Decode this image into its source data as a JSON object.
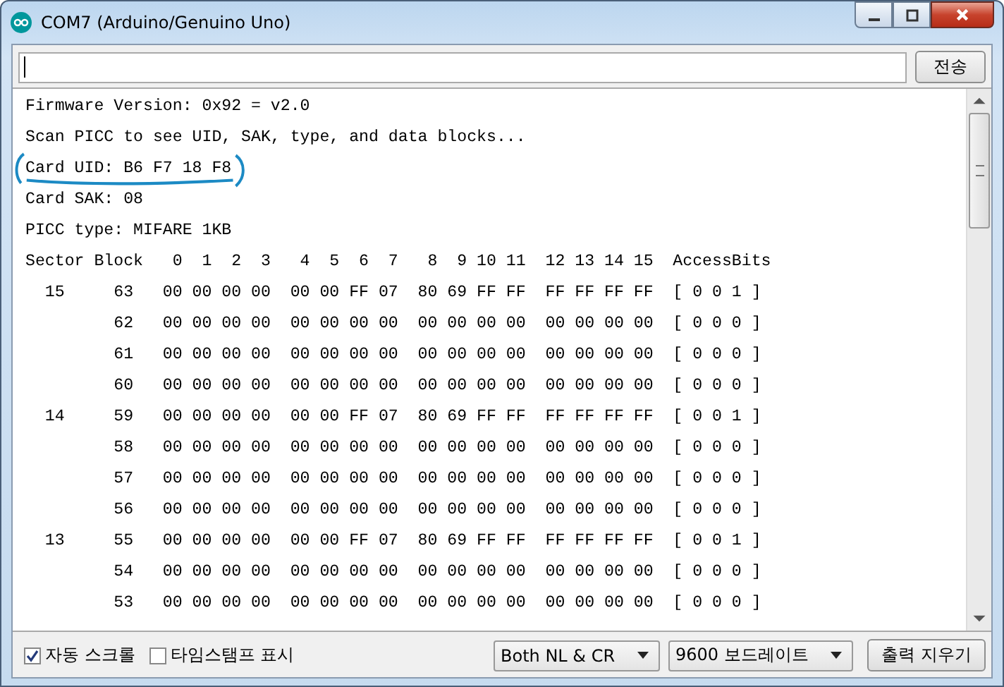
{
  "window": {
    "title": "COM7 (Arduino/Genuino Uno)"
  },
  "send_button": "전송",
  "console_lines": [
    {
      "text": "Firmware Version: 0x92 = v2.0",
      "circled": false
    },
    {
      "text": "Scan PICC to see UID, SAK, type, and data blocks...",
      "circled": false
    },
    {
      "text": "Card UID: B6 F7 18 F8",
      "circled": true
    },
    {
      "text": "Card SAK: 08",
      "circled": false
    },
    {
      "text": "PICC type: MIFARE 1KB",
      "circled": false
    },
    {
      "text": "Sector Block   0  1  2  3   4  5  6  7   8  9 10 11  12 13 14 15  AccessBits",
      "circled": false
    },
    {
      "text": "  15     63   00 00 00 00  00 00 FF 07  80 69 FF FF  FF FF FF FF  [ 0 0 1 ]",
      "circled": false
    },
    {
      "text": "         62   00 00 00 00  00 00 00 00  00 00 00 00  00 00 00 00  [ 0 0 0 ]",
      "circled": false
    },
    {
      "text": "         61   00 00 00 00  00 00 00 00  00 00 00 00  00 00 00 00  [ 0 0 0 ]",
      "circled": false
    },
    {
      "text": "         60   00 00 00 00  00 00 00 00  00 00 00 00  00 00 00 00  [ 0 0 0 ]",
      "circled": false
    },
    {
      "text": "  14     59   00 00 00 00  00 00 FF 07  80 69 FF FF  FF FF FF FF  [ 0 0 1 ]",
      "circled": false
    },
    {
      "text": "         58   00 00 00 00  00 00 00 00  00 00 00 00  00 00 00 00  [ 0 0 0 ]",
      "circled": false
    },
    {
      "text": "         57   00 00 00 00  00 00 00 00  00 00 00 00  00 00 00 00  [ 0 0 0 ]",
      "circled": false
    },
    {
      "text": "         56   00 00 00 00  00 00 00 00  00 00 00 00  00 00 00 00  [ 0 0 0 ]",
      "circled": false
    },
    {
      "text": "  13     55   00 00 00 00  00 00 FF 07  80 69 FF FF  FF FF FF FF  [ 0 0 1 ]",
      "circled": false
    },
    {
      "text": "         54   00 00 00 00  00 00 00 00  00 00 00 00  00 00 00 00  [ 0 0 0 ]",
      "circled": false
    },
    {
      "text": "         53   00 00 00 00  00 00 00 00  00 00 00 00  00 00 00 00  [ 0 0 0 ]",
      "circled": false
    }
  ],
  "options": [
    {
      "label": "자동 스크롤",
      "checked": true
    },
    {
      "label": "타임스탬프 표시",
      "checked": false
    }
  ],
  "line_ending": "Both NL & CR",
  "baud_rate": "9600 보드레이트",
  "clear_button": "출력 지우기"
}
